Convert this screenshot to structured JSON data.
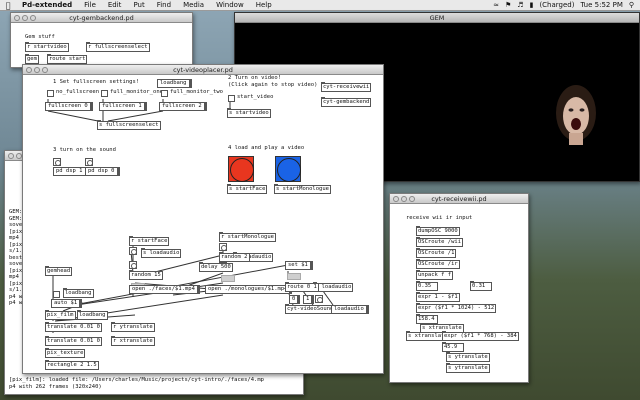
{
  "menubar": {
    "apple": "",
    "app": "Pd-extended",
    "items": [
      "File",
      "Edit",
      "Put",
      "Find",
      "Media",
      "Window",
      "Help"
    ],
    "battery": "(Charged)",
    "clock": "Tue 5:52 PM"
  },
  "gembackend": {
    "title": "cyt-gembackend.pd",
    "comment": "Gem stuff",
    "objects": [
      "r startvideo",
      "r fullscreenselect",
      "route start"
    ],
    "partial": "gem"
  },
  "gem_window": {
    "title": "GEM"
  },
  "videoplacer": {
    "title": "cyt-videoplacer.pd",
    "step1": "1 Set fullscreen settings!",
    "loadbang_1": "loadbang",
    "toggle_no_fullscreen": "no_fullscreen",
    "toggle_fullmonitor_one": "full_monitor_one",
    "toggle_fullmonitor_two": "full_monitor_two",
    "msg_fullscreen0": "fullscreen 0",
    "msg_fullscreen1": "fullscreen 1",
    "msg_fullscreen2": "fullscreen 2",
    "obj_s_fullscreenselect": "s fullscreenselect",
    "step2_line1": "2 Turn on video!",
    "step2_line2": "(Click again to stop video)",
    "toggle_start_video": "start_video",
    "obj_s_startvideo": "s startvideo",
    "obj_cyt_receivewii": "cyt-receivewii",
    "obj_cyt_gembackend": "cyt-gembackend",
    "step3": "3 turn on the sound",
    "msg_pd_dsp_1": "pd dsp 1",
    "msg_pd_dsp_0": "pd dsp 0",
    "step4": "4 load and play a video",
    "obj_s_startface": "s startFace",
    "obj_s_startmonologue": "s startMonologue",
    "colors": {
      "face_bang": "#e8361f",
      "monologue_bang": "#1a63e6"
    },
    "console_lines": [
      "GEM:",
      "GEM:",
      "sove",
      "[pix",
      "mp4",
      "[pix",
      "s/1.",
      "beste",
      "sove",
      "[pix",
      "mp4",
      "[pix",
      "s/1.",
      "p4 w",
      "p4 w"
    ],
    "console_bottom_1": "[pix_film]: loaded file: /Users/charles/Music/projects/cyt-intro/./faces/4.mp",
    "console_bottom_2": "p4 with 262 frames (320x240)",
    "lower": {
      "r_startface": "r startFace",
      "r_startmonologue": "r startMonologue",
      "s_loadaudio_a": "s loadaudio",
      "s_loadaudio_b": "s loadaudio",
      "random_15": "random 15",
      "random_2": "random 2",
      "delay_500": "delay 500",
      "set_1": "set $1",
      "r_loadaudio": "r loadaudio",
      "open_faces": "open ./faces/$1.mp4",
      "open_monologues": "open ./monologues/$1.mp4",
      "gemhead": "gemhead",
      "loadbang_2": "loadbang",
      "loadbang_3": "loadbang",
      "auto_1": "auto $1",
      "pix_film": "pix_film",
      "translate_a": "translate 0.01 0",
      "translate_b": "translate 0.01 0",
      "r_ytranslate": "r ytranslate",
      "r_xtranslate": "r xtranslate",
      "pix_texture": "pix_texture",
      "rectangle": "rectangle 2 1.5",
      "route_0_1": "route 0 1",
      "cyt_video_sound": "cyt-videoSound",
      "loadaudio": "loadaudio",
      "num_0": "0",
      "num_1": "1"
    }
  },
  "receivewii": {
    "title": "cyt-receivewii.pd",
    "comment": "receive wii ir input",
    "objects": [
      "dumpOSC 9000",
      "OSCroute /wii",
      "OSCroute /1",
      "OSCroute /ir",
      "unpack f f",
      "0.35",
      "0.31",
      "expr 1 - $f1",
      "expr ($f1 * 1024) - 512",
      "158.4",
      "s xtranslate",
      "s xtranslate",
      "expr ($f1 * 768) - 384",
      "45.9",
      "s ytranslate",
      "s ytranslate"
    ]
  }
}
